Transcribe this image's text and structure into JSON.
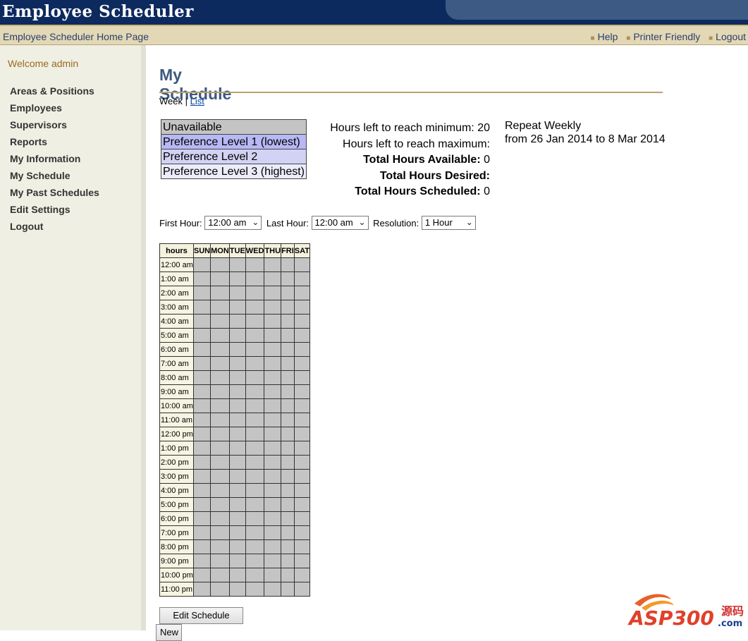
{
  "app": {
    "title": "Employee Scheduler"
  },
  "navbar": {
    "home": "Employee Scheduler Home Page",
    "links": [
      "Help",
      "Printer Friendly",
      "Logout"
    ]
  },
  "sidebar": {
    "welcome": "Welcome admin",
    "items": [
      {
        "label": "Areas & Positions"
      },
      {
        "label": "Employees"
      },
      {
        "label": "Supervisors"
      },
      {
        "label": "Reports"
      },
      {
        "label": "My Information"
      },
      {
        "label": "My Schedule"
      },
      {
        "label": "My Past Schedules"
      },
      {
        "label": "Edit Settings"
      },
      {
        "label": "Logout"
      }
    ]
  },
  "main": {
    "heading": "My Schedule",
    "view_week": "Week",
    "view_sep": "|",
    "view_list": "List",
    "legend": [
      {
        "label": "Unavailable",
        "color": "#c4c4c4"
      },
      {
        "label": "Preference Level 1 (lowest)",
        "color": "#b8b8f5"
      },
      {
        "label": "Preference Level 2",
        "color": "#d2d2f5"
      },
      {
        "label": "Preference Level 3 (highest)",
        "color": "#ececfb"
      }
    ],
    "stats": {
      "min_label": "Hours left to reach minimum:",
      "min_value": "20",
      "max_label": "Hours left to reach maximum:",
      "max_value": "",
      "available_label": "Total Hours Available:",
      "available_value": "0",
      "desired_label": "Total Hours Desired:",
      "desired_value": "",
      "scheduled_label": "Total Hours Scheduled:",
      "scheduled_value": "0"
    },
    "repeat": {
      "line1": "Repeat Weekly",
      "line2": "from 26 Jan 2014 to 8 Mar 2014"
    },
    "controls": {
      "first_hour_label": "First Hour:",
      "first_hour_value": "12:00 am",
      "last_hour_label": "Last Hour:",
      "last_hour_value": "12:00 am",
      "resolution_label": "Resolution:",
      "resolution_value": "1 Hour"
    },
    "schedule": {
      "hours_header": "hours",
      "days": [
        "SUN",
        "MON",
        "TUE",
        "WED",
        "THU",
        "FRI",
        "SAT"
      ],
      "hours": [
        "12:00 am",
        "1:00 am",
        "2:00 am",
        "3:00 am",
        "4:00 am",
        "5:00 am",
        "6:00 am",
        "7:00 am",
        "8:00 am",
        "9:00 am",
        "10:00 am",
        "11:00 am",
        "12:00 pm",
        "1:00 pm",
        "2:00 pm",
        "3:00 pm",
        "4:00 pm",
        "5:00 pm",
        "6:00 pm",
        "7:00 pm",
        "8:00 pm",
        "9:00 pm",
        "10:00 pm",
        "11:00 pm"
      ],
      "cell_state": "Unavailable"
    },
    "buttons": {
      "edit": "Edit Schedule",
      "new": "New"
    }
  },
  "watermark": {
    "text": "ASP300",
    "cn": "源码",
    "com": ".com"
  }
}
